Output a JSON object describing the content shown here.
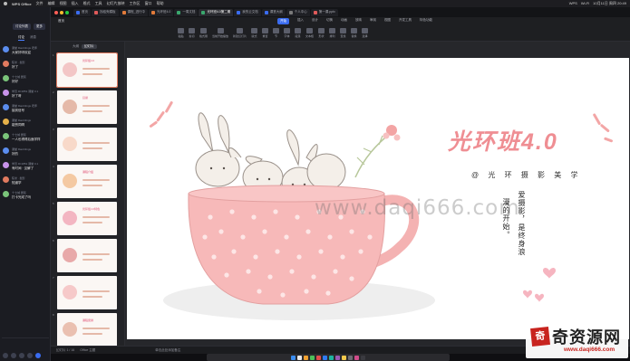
{
  "menubar": {
    "app_name": "WPS Office",
    "items": [
      "文件",
      "编辑",
      "视图",
      "插入",
      "格式",
      "工具",
      "幻灯片放映",
      "工作区",
      "窗口",
      "帮助"
    ],
    "right_items": [
      "WPS",
      "Wi-Fi",
      "10月11日 周四 20:49"
    ]
  },
  "chat": {
    "buttons": [
      "讨论列表",
      "更多"
    ],
    "tabs": [
      "讨论",
      "消息"
    ],
    "messages": [
      {
        "name": "课堂 Ramblings 老师",
        "text": "大家好呀欢迎",
        "color": "#5b8def"
      },
      {
        "name": "陈米 · 摄影",
        "text": "好了",
        "color": "#e07a5f"
      },
      {
        "name": "十七城 居民",
        "text": "好好",
        "color": "#7ac47a"
      },
      {
        "name": "学员 ID:2851 课堂 0.1",
        "text": "好了呀",
        "color": "#c792ea"
      },
      {
        "name": "课堂 Ramblings 老师",
        "text": "接到信号",
        "color": "#5b8def"
      },
      {
        "name": "课堂 Ramblings",
        "text": "能赞同啊",
        "color": "#e6b14a"
      },
      {
        "name": "十七城 居民",
        "text": "一人也得得后面学样",
        "color": "#7ac47a"
      },
      {
        "name": "课堂 Ramblings",
        "text": "好的",
        "color": "#5b8def"
      },
      {
        "name": "学员 ID:2851 课堂 0.1",
        "text": "有时间 · 见解了",
        "color": "#c792ea"
      },
      {
        "name": "陈米 · 摄影",
        "text": "知道学",
        "color": "#e07a5f"
      },
      {
        "name": "十七城 居民",
        "text": "打卡完成了吗",
        "color": "#7ac47a"
      }
    ]
  },
  "window": {
    "tabs": [
      {
        "label": "首页",
        "color": "#3a6cf0",
        "active": false
      },
      {
        "label": "找稻壳模板",
        "color": "#e05a5a",
        "active": false
      },
      {
        "label": "课程_进行中",
        "color": "#e27b3a",
        "active": false
      },
      {
        "label": "光环班4.0",
        "color": "#e27b3a",
        "active": false
      },
      {
        "label": "一周文档",
        "color": "#3aa76d",
        "active": false
      },
      {
        "label": "光环班4.0第二期",
        "color": "#3aa76d",
        "active": true
      },
      {
        "label": "我的云文档",
        "color": "#3a6cf0",
        "active": false
      },
      {
        "label": "课堂大纲",
        "color": "#3a6cf0",
        "active": false
      },
      {
        "label": "个人中心",
        "color": "#7a7a7a",
        "active": false
      },
      {
        "label": "第一课.pptx",
        "color": "#e05a5a",
        "active": false
      }
    ],
    "ribbon_start": "首页",
    "ribbon_tabs": [
      "开始",
      "插入",
      "设计",
      "切换",
      "动画",
      "放映",
      "审阅",
      "视图",
      "开发工具",
      "特色功能"
    ],
    "ribbon_active": "开始",
    "ribbon_buttons": [
      "粘贴",
      "剪切",
      "格式刷",
      "当前开始播放",
      "新建幻灯片",
      "版式",
      "重置",
      "节",
      "字体",
      "段落",
      "文本框",
      "形状",
      "排列",
      "查找",
      "替换",
      "选择"
    ]
  },
  "pane": {
    "tabs": [
      "大纲",
      "幻灯片"
    ],
    "active": "幻灯片",
    "thumbs": [
      {
        "num": "1",
        "title": "光环班4.0"
      },
      {
        "num": "2",
        "title": "目录"
      },
      {
        "num": "3",
        "title": ""
      },
      {
        "num": "4",
        "title": "课程介绍"
      },
      {
        "num": "5",
        "title": "光环班4.0特色"
      },
      {
        "num": "6",
        "title": ""
      },
      {
        "num": "7",
        "title": ""
      },
      {
        "num": "8",
        "title": "课程安排"
      }
    ]
  },
  "slide": {
    "title": "光环班4.0",
    "subtitle": "@ 光 环 摄 影 美 学",
    "vertical_1": "爱摄影，是终身浪",
    "vertical_2": "漫的开始。",
    "watermark": "www.daqi666.com"
  },
  "status": {
    "left": "幻灯片 1 / 16",
    "theme": "Office 主题",
    "mid": "单击此处添加备注",
    "zoom": "64%"
  },
  "logo": {
    "seal": "奇",
    "brand": "奇资源网",
    "url": "www.daqi666.com"
  },
  "colors": {
    "accent": "#3a6cf0",
    "title_pink": "#ef8e93",
    "cup_pink": "#f7b9b9"
  }
}
